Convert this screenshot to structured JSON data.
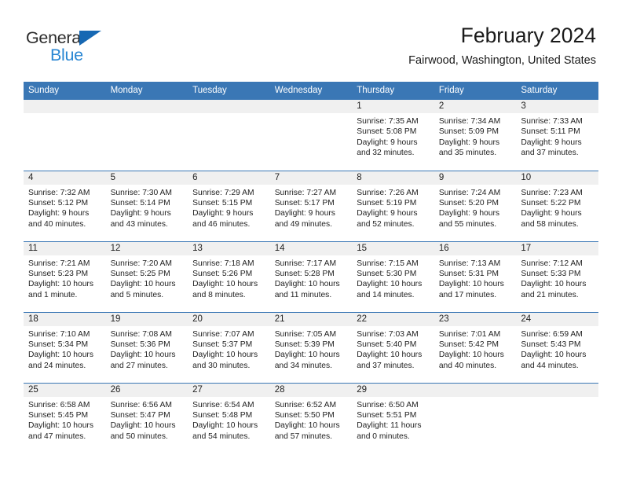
{
  "logo": {
    "text_top": "General",
    "text_bottom": "Blue",
    "triangle_color": "#1668b3",
    "blue_color": "#2a87d3"
  },
  "header": {
    "title": "February 2024",
    "subtitle": "Fairwood, Washington, United States"
  },
  "theme": {
    "header_blue": "#3a77b5",
    "band_gray": "#f0f0f0",
    "text": "#222222"
  },
  "weekday_headers": [
    "Sunday",
    "Monday",
    "Tuesday",
    "Wednesday",
    "Thursday",
    "Friday",
    "Saturday"
  ],
  "weeks": [
    [
      {
        "day": "",
        "sunrise": "",
        "sunset": "",
        "daylight1": "",
        "daylight2": ""
      },
      {
        "day": "",
        "sunrise": "",
        "sunset": "",
        "daylight1": "",
        "daylight2": ""
      },
      {
        "day": "",
        "sunrise": "",
        "sunset": "",
        "daylight1": "",
        "daylight2": ""
      },
      {
        "day": "",
        "sunrise": "",
        "sunset": "",
        "daylight1": "",
        "daylight2": ""
      },
      {
        "day": "1",
        "sunrise": "Sunrise: 7:35 AM",
        "sunset": "Sunset: 5:08 PM",
        "daylight1": "Daylight: 9 hours",
        "daylight2": "and 32 minutes."
      },
      {
        "day": "2",
        "sunrise": "Sunrise: 7:34 AM",
        "sunset": "Sunset: 5:09 PM",
        "daylight1": "Daylight: 9 hours",
        "daylight2": "and 35 minutes."
      },
      {
        "day": "3",
        "sunrise": "Sunrise: 7:33 AM",
        "sunset": "Sunset: 5:11 PM",
        "daylight1": "Daylight: 9 hours",
        "daylight2": "and 37 minutes."
      }
    ],
    [
      {
        "day": "4",
        "sunrise": "Sunrise: 7:32 AM",
        "sunset": "Sunset: 5:12 PM",
        "daylight1": "Daylight: 9 hours",
        "daylight2": "and 40 minutes."
      },
      {
        "day": "5",
        "sunrise": "Sunrise: 7:30 AM",
        "sunset": "Sunset: 5:14 PM",
        "daylight1": "Daylight: 9 hours",
        "daylight2": "and 43 minutes."
      },
      {
        "day": "6",
        "sunrise": "Sunrise: 7:29 AM",
        "sunset": "Sunset: 5:15 PM",
        "daylight1": "Daylight: 9 hours",
        "daylight2": "and 46 minutes."
      },
      {
        "day": "7",
        "sunrise": "Sunrise: 7:27 AM",
        "sunset": "Sunset: 5:17 PM",
        "daylight1": "Daylight: 9 hours",
        "daylight2": "and 49 minutes."
      },
      {
        "day": "8",
        "sunrise": "Sunrise: 7:26 AM",
        "sunset": "Sunset: 5:19 PM",
        "daylight1": "Daylight: 9 hours",
        "daylight2": "and 52 minutes."
      },
      {
        "day": "9",
        "sunrise": "Sunrise: 7:24 AM",
        "sunset": "Sunset: 5:20 PM",
        "daylight1": "Daylight: 9 hours",
        "daylight2": "and 55 minutes."
      },
      {
        "day": "10",
        "sunrise": "Sunrise: 7:23 AM",
        "sunset": "Sunset: 5:22 PM",
        "daylight1": "Daylight: 9 hours",
        "daylight2": "and 58 minutes."
      }
    ],
    [
      {
        "day": "11",
        "sunrise": "Sunrise: 7:21 AM",
        "sunset": "Sunset: 5:23 PM",
        "daylight1": "Daylight: 10 hours",
        "daylight2": "and 1 minute."
      },
      {
        "day": "12",
        "sunrise": "Sunrise: 7:20 AM",
        "sunset": "Sunset: 5:25 PM",
        "daylight1": "Daylight: 10 hours",
        "daylight2": "and 5 minutes."
      },
      {
        "day": "13",
        "sunrise": "Sunrise: 7:18 AM",
        "sunset": "Sunset: 5:26 PM",
        "daylight1": "Daylight: 10 hours",
        "daylight2": "and 8 minutes."
      },
      {
        "day": "14",
        "sunrise": "Sunrise: 7:17 AM",
        "sunset": "Sunset: 5:28 PM",
        "daylight1": "Daylight: 10 hours",
        "daylight2": "and 11 minutes."
      },
      {
        "day": "15",
        "sunrise": "Sunrise: 7:15 AM",
        "sunset": "Sunset: 5:30 PM",
        "daylight1": "Daylight: 10 hours",
        "daylight2": "and 14 minutes."
      },
      {
        "day": "16",
        "sunrise": "Sunrise: 7:13 AM",
        "sunset": "Sunset: 5:31 PM",
        "daylight1": "Daylight: 10 hours",
        "daylight2": "and 17 minutes."
      },
      {
        "day": "17",
        "sunrise": "Sunrise: 7:12 AM",
        "sunset": "Sunset: 5:33 PM",
        "daylight1": "Daylight: 10 hours",
        "daylight2": "and 21 minutes."
      }
    ],
    [
      {
        "day": "18",
        "sunrise": "Sunrise: 7:10 AM",
        "sunset": "Sunset: 5:34 PM",
        "daylight1": "Daylight: 10 hours",
        "daylight2": "and 24 minutes."
      },
      {
        "day": "19",
        "sunrise": "Sunrise: 7:08 AM",
        "sunset": "Sunset: 5:36 PM",
        "daylight1": "Daylight: 10 hours",
        "daylight2": "and 27 minutes."
      },
      {
        "day": "20",
        "sunrise": "Sunrise: 7:07 AM",
        "sunset": "Sunset: 5:37 PM",
        "daylight1": "Daylight: 10 hours",
        "daylight2": "and 30 minutes."
      },
      {
        "day": "21",
        "sunrise": "Sunrise: 7:05 AM",
        "sunset": "Sunset: 5:39 PM",
        "daylight1": "Daylight: 10 hours",
        "daylight2": "and 34 minutes."
      },
      {
        "day": "22",
        "sunrise": "Sunrise: 7:03 AM",
        "sunset": "Sunset: 5:40 PM",
        "daylight1": "Daylight: 10 hours",
        "daylight2": "and 37 minutes."
      },
      {
        "day": "23",
        "sunrise": "Sunrise: 7:01 AM",
        "sunset": "Sunset: 5:42 PM",
        "daylight1": "Daylight: 10 hours",
        "daylight2": "and 40 minutes."
      },
      {
        "day": "24",
        "sunrise": "Sunrise: 6:59 AM",
        "sunset": "Sunset: 5:43 PM",
        "daylight1": "Daylight: 10 hours",
        "daylight2": "and 44 minutes."
      }
    ],
    [
      {
        "day": "25",
        "sunrise": "Sunrise: 6:58 AM",
        "sunset": "Sunset: 5:45 PM",
        "daylight1": "Daylight: 10 hours",
        "daylight2": "and 47 minutes."
      },
      {
        "day": "26",
        "sunrise": "Sunrise: 6:56 AM",
        "sunset": "Sunset: 5:47 PM",
        "daylight1": "Daylight: 10 hours",
        "daylight2": "and 50 minutes."
      },
      {
        "day": "27",
        "sunrise": "Sunrise: 6:54 AM",
        "sunset": "Sunset: 5:48 PM",
        "daylight1": "Daylight: 10 hours",
        "daylight2": "and 54 minutes."
      },
      {
        "day": "28",
        "sunrise": "Sunrise: 6:52 AM",
        "sunset": "Sunset: 5:50 PM",
        "daylight1": "Daylight: 10 hours",
        "daylight2": "and 57 minutes."
      },
      {
        "day": "29",
        "sunrise": "Sunrise: 6:50 AM",
        "sunset": "Sunset: 5:51 PM",
        "daylight1": "Daylight: 11 hours",
        "daylight2": "and 0 minutes."
      },
      {
        "day": "",
        "sunrise": "",
        "sunset": "",
        "daylight1": "",
        "daylight2": ""
      },
      {
        "day": "",
        "sunrise": "",
        "sunset": "",
        "daylight1": "",
        "daylight2": ""
      }
    ]
  ]
}
